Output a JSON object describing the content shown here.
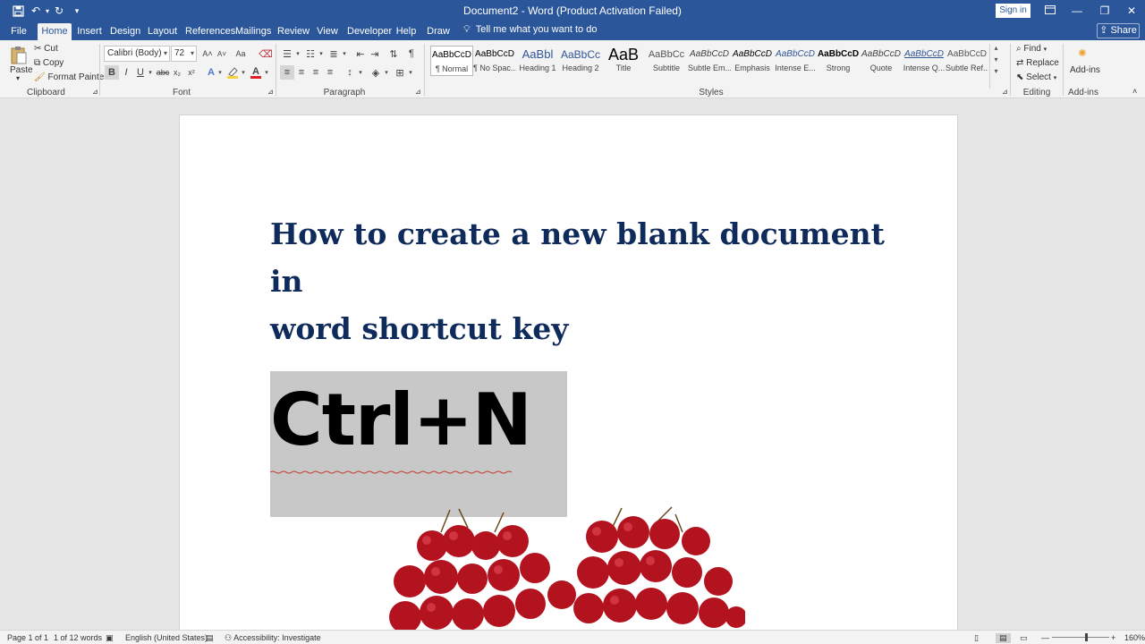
{
  "titlebar": {
    "title": "Document2 - Word (Product Activation Failed)",
    "sign_in": "Sign in",
    "save_icon": "save-icon",
    "undo_icon": "undo-icon",
    "redo_icon": "redo-icon",
    "customize_icon": "customize-quick-access-icon"
  },
  "tabs": {
    "file": "File",
    "home": "Home",
    "insert": "Insert",
    "design": "Design",
    "layout": "Layout",
    "references": "References",
    "mailings": "Mailings",
    "review": "Review",
    "view": "View",
    "developer": "Developer",
    "help": "Help",
    "draw": "Draw",
    "tell_me": "Tell me what you want to do",
    "share": "Share"
  },
  "clipboard": {
    "paste": "Paste",
    "cut": "Cut",
    "copy": "Copy",
    "format_painter": "Format Painter",
    "label": "Clipboard"
  },
  "font": {
    "family": "Calibri (Body)",
    "size": "72",
    "label": "Font",
    "bold": "B",
    "italic": "I",
    "underline": "U",
    "strike": "abc",
    "subscript": "x₂",
    "superscript": "x²",
    "grow": "A˄",
    "shrink": "A˅",
    "change_case": "Aa",
    "font_color": "A",
    "highlight_color": "#f5d33b",
    "font_color_hex": "#e02020"
  },
  "paragraph": {
    "label": "Paragraph",
    "show_marks": "¶"
  },
  "styles": {
    "label": "Styles",
    "items": [
      {
        "sample": "AaBbCcD",
        "name": "¶ Normal"
      },
      {
        "sample": "AaBbCcD",
        "name": "¶ No Spac..."
      },
      {
        "sample": "AaBbl",
        "name": "Heading 1"
      },
      {
        "sample": "AaBbCc",
        "name": "Heading 2"
      },
      {
        "sample": "AaB",
        "name": "Title"
      },
      {
        "sample": "AaBbCc",
        "name": "Subtitle"
      },
      {
        "sample": "AaBbCcD",
        "name": "Subtle Em..."
      },
      {
        "sample": "AaBbCcD",
        "name": "Emphasis"
      },
      {
        "sample": "AaBbCcD",
        "name": "Intense E..."
      },
      {
        "sample": "AaBbCcD",
        "name": "Strong"
      },
      {
        "sample": "AaBbCcD",
        "name": "Quote"
      },
      {
        "sample": "AaBbCcD",
        "name": "Intense Q..."
      },
      {
        "sample": "AaBbCcD",
        "name": "Subtle Ref..."
      }
    ]
  },
  "editing": {
    "find": "Find",
    "replace": "Replace",
    "select": "Select",
    "label": "Editing"
  },
  "addins": {
    "button": "Add-ins",
    "label": "Add-ins"
  },
  "document": {
    "heading_line1": "How to create a new blank document in",
    "heading_line2": "word shortcut key",
    "shortcut": "Ctrl+N"
  },
  "status": {
    "page": "Page 1 of 1",
    "words": "1 of 12 words",
    "language": "English (United States)",
    "accessibility": "Accessibility: Investigate",
    "zoom": "160%",
    "zoom_value": 1.6
  },
  "colors": {
    "accent": "#2b579a",
    "heading": "#0f2b5b",
    "selection_bg": "#c8c8c8"
  }
}
